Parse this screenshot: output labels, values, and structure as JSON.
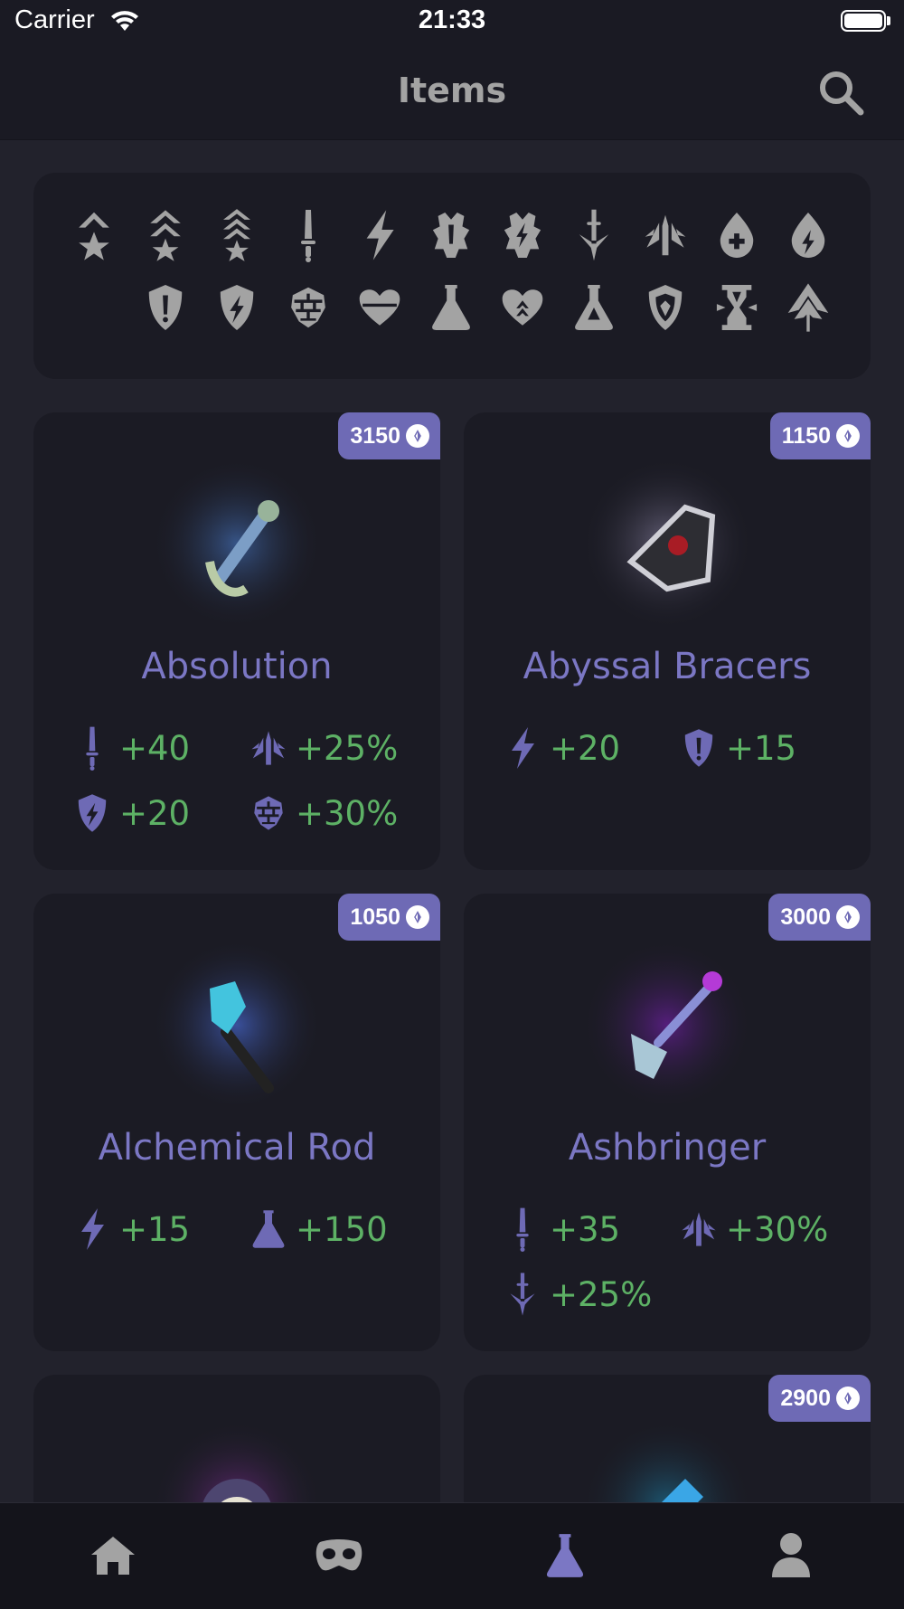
{
  "status": {
    "carrier": "Carrier",
    "time": "21:33"
  },
  "header": {
    "title": "Items"
  },
  "filters": [
    "tier-one-icon",
    "tier-two-icon",
    "tier-three-icon",
    "physical-power-icon",
    "magical-power-icon",
    "physical-lifesteal-icon",
    "magical-lifesteal-icon",
    "physical-penetration-icon",
    "attack-speed-icon",
    "health-icon",
    "mana-icon",
    "hp5-icon",
    "physical-protection-icon",
    "magical-protection-icon",
    "crowd-control-reduction-icon",
    "max-health-icon",
    "mana-potion-icon",
    "health-regen-icon",
    "potion-icon",
    "aura-icon",
    "cooldown-reduction-icon",
    "movement-speed-icon"
  ],
  "items": [
    {
      "name": "Absolution",
      "cost": "3150",
      "stats": [
        {
          "icon": "physical-power-icon",
          "value": "+40"
        },
        {
          "icon": "attack-speed-icon",
          "value": "+25%"
        },
        {
          "icon": "magical-protection-icon",
          "value": "+20"
        },
        {
          "icon": "crowd-control-reduction-icon",
          "value": "+30%"
        }
      ]
    },
    {
      "name": "Abyssal Bracers",
      "cost": "1150",
      "stats": [
        {
          "icon": "magical-power-icon",
          "value": "+20"
        },
        {
          "icon": "physical-protection-icon",
          "value": "+15"
        }
      ]
    },
    {
      "name": "Alchemical Rod",
      "cost": "1050",
      "stats": [
        {
          "icon": "magical-power-icon",
          "value": "+15"
        },
        {
          "icon": "mana-potion-icon",
          "value": "+150"
        }
      ]
    },
    {
      "name": "Ashbringer",
      "cost": "3000",
      "stats": [
        {
          "icon": "physical-power-icon",
          "value": "+35"
        },
        {
          "icon": "attack-speed-icon",
          "value": "+30%"
        },
        {
          "icon": "physical-penetration-icon",
          "value": "+25%"
        }
      ]
    },
    {
      "name": "",
      "cost": "",
      "stats": []
    },
    {
      "name": "",
      "cost": "2900",
      "stats": []
    }
  ],
  "tabs": [
    "home-icon",
    "gods-mask-icon",
    "items-flask-icon",
    "profile-icon"
  ],
  "colors": {
    "accent": "#6e6ab5",
    "stat_green": "#5db165",
    "icon_gray": "#a3a3a3",
    "active_tab": "#7b77c4"
  }
}
